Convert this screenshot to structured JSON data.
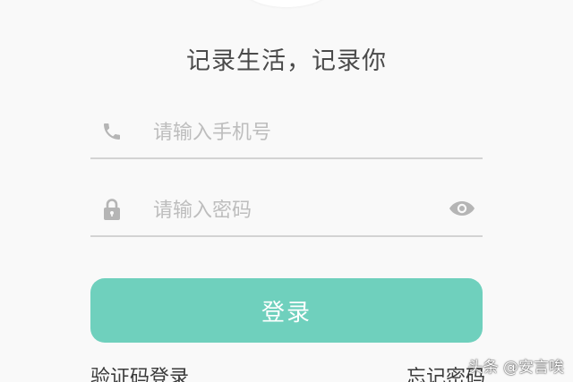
{
  "header": {
    "slogan": "记录生活，记录你"
  },
  "form": {
    "phone": {
      "placeholder": "请输入手机号",
      "value": "",
      "icon": "phone-icon"
    },
    "password": {
      "placeholder": "请输入密码",
      "value": "",
      "icon": "lock-icon",
      "toggle_icon": "eye-icon"
    },
    "login_label": "登录"
  },
  "footer": {
    "sms_login_label": "验证码登录",
    "forgot_password_label": "忘记密码"
  },
  "watermark": "头条 @安言唉",
  "colors": {
    "accent": "#6fd0bd",
    "background": "#f9f9f9",
    "icon_gray": "#b5b5b5",
    "divider": "#d3d3d3"
  }
}
